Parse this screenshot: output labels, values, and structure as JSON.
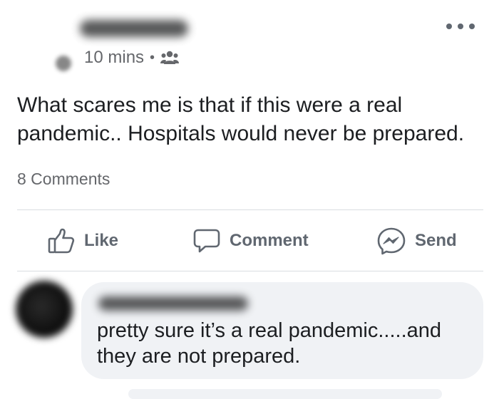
{
  "post": {
    "timestamp": "10 mins",
    "separator": "•",
    "audience_icon": "friends-icon",
    "text": "What scares me is that if this were a real pandemic.. Hospitals would never be prepared.",
    "comment_count": "8 Comments"
  },
  "actions": {
    "like_label": "Like",
    "comment_label": "Comment",
    "send_label": "Send"
  },
  "comment": {
    "text": "pretty sure it’s a real pandemic.....and they are not prepared."
  },
  "colors": {
    "text_primary": "#1c1e21",
    "text_secondary": "#65676b",
    "bubble_bg": "#f0f2f5",
    "divider": "#dadde1"
  }
}
